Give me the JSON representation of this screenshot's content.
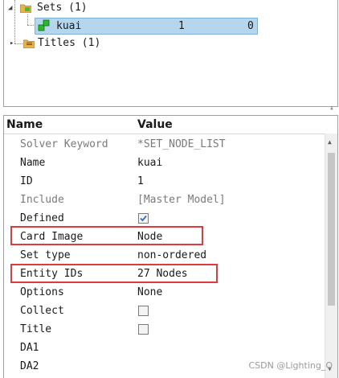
{
  "tree": {
    "sets_label": "Sets (1)",
    "set_item": {
      "name": "kuai",
      "col1": "1",
      "col2": "0"
    },
    "titles_label": "Titles (1)"
  },
  "properties": {
    "header_name": "Name",
    "header_value": "Value",
    "rows": [
      {
        "name": "Solver Keyword",
        "value": "*SET_NODE_LIST"
      },
      {
        "name": "Name",
        "value": "kuai"
      },
      {
        "name": "ID",
        "value": "1"
      },
      {
        "name": "Include",
        "value": "[Master Model]"
      },
      {
        "name": "Defined",
        "value": ""
      },
      {
        "name": "Card Image",
        "value": "Node"
      },
      {
        "name": "Set type",
        "value": "non-ordered"
      },
      {
        "name": "Entity IDs",
        "value": "27 Nodes"
      },
      {
        "name": "Options",
        "value": "None"
      },
      {
        "name": "Collect",
        "value": ""
      },
      {
        "name": "Title",
        "value": ""
      },
      {
        "name": "DA1",
        "value": ""
      },
      {
        "name": "DA2",
        "value": ""
      }
    ],
    "defined_checked": true,
    "collect_checked": false,
    "title_checked": false
  },
  "watermark": "CSDN @Lighting_Q",
  "colors": {
    "selection": "#b6d6ee",
    "highlight_box": "#e0393e",
    "check": "#2f6fc0"
  }
}
